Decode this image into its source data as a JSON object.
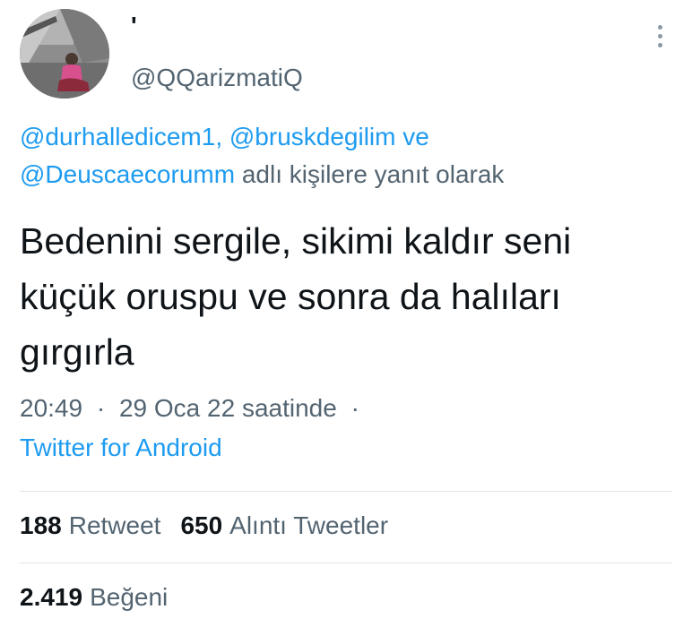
{
  "tweet": {
    "display_name": "'",
    "handle": "@QQarizmatiQ",
    "reply_to": {
      "mention_1": "@durhalledicem1,",
      "mention_2": "@bruskdegilim",
      "conjunction": "ve",
      "mention_3": "@Deuscaecorumm",
      "suffix": "adlı kişilere yanıt olarak"
    },
    "text": "Bedenini sergile, sikimi kaldır seni küçük oruspu ve sonra da halıları gırgırla",
    "time": "20:49",
    "date": "29 Oca 22 saatinde",
    "separator": "·",
    "source": "Twitter for Android"
  },
  "stats": {
    "retweet_count": "188",
    "retweet_label": "Retweet",
    "quote_count": "650",
    "quote_label": "Alıntı Tweetler",
    "like_count": "2.419",
    "like_label": "Beğeni"
  },
  "colors": {
    "link": "#1d9bf0",
    "secondary": "#536471",
    "primary": "#0f1419"
  },
  "icons": {
    "more": "more-vertical-icon"
  }
}
